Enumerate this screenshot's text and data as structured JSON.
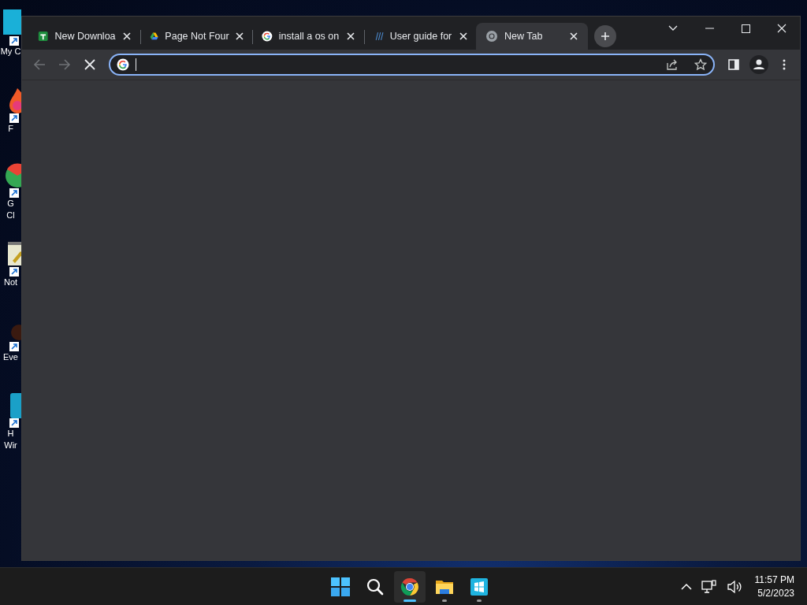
{
  "desktop_icons": [
    {
      "kind": "computer",
      "label_lines": [
        "My C"
      ]
    },
    {
      "kind": "flame",
      "label_lines": [
        "F"
      ]
    },
    {
      "kind": "round",
      "label_lines": [
        "G",
        "Cl"
      ]
    },
    {
      "kind": "notepad",
      "label_lines": [
        "Not"
      ]
    },
    {
      "kind": "dark",
      "label_lines": [
        "Eve"
      ]
    },
    {
      "kind": "phone",
      "label_lines": [
        "H",
        "Wir"
      ]
    }
  ],
  "browser": {
    "tabs": [
      {
        "title": "New Downloa",
        "selected": false
      },
      {
        "title": "Page Not Four",
        "selected": false
      },
      {
        "title": "install a os on",
        "selected": false
      },
      {
        "title": "User guide for",
        "selected": false
      },
      {
        "title": "New Tab",
        "selected": true
      }
    ],
    "toolbar": {
      "back_disabled": true,
      "forward_disabled": true,
      "loading": true
    },
    "address_field": {
      "focused": true
    }
  },
  "taskbar": {
    "apps": [
      {
        "kind": "start"
      },
      {
        "kind": "search"
      },
      {
        "kind": "chrome",
        "running": true,
        "active": true
      },
      {
        "kind": "explorer",
        "running": true,
        "active": false
      },
      {
        "kind": "store",
        "running": true,
        "active": false
      }
    ],
    "time": "11:57 PM",
    "date": "5/2/2023"
  }
}
